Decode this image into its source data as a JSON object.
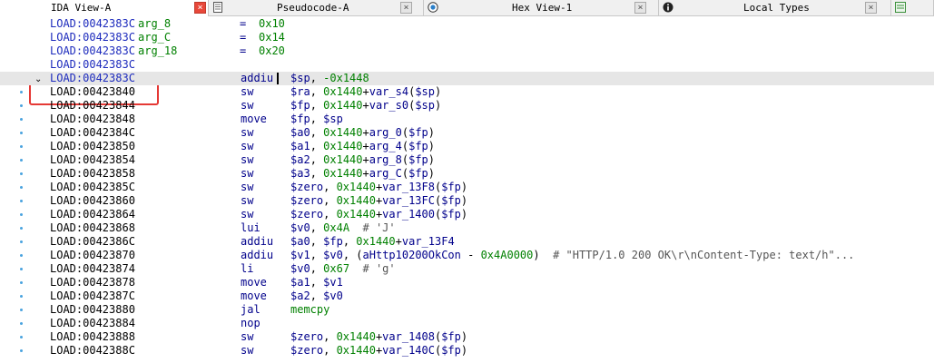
{
  "tabs": [
    {
      "label": "IDA View-A",
      "icon": "grid-icon",
      "active": true
    },
    {
      "label": "Pseudocode-A",
      "icon": "document-icon",
      "active": false
    },
    {
      "label": "Hex View-1",
      "icon": "hex-icon",
      "active": false
    },
    {
      "label": "Local Types",
      "icon": "info-icon",
      "active": false
    },
    {
      "label": "",
      "icon": "struct-icon",
      "active": false
    }
  ],
  "close_glyph": "×",
  "collapse_glyph": "⌄",
  "stack_vars": [
    {
      "addr": "LOAD:0042383C",
      "name": "arg_8",
      "eq": "=",
      "value": "0x10"
    },
    {
      "addr": "LOAD:0042383C",
      "name": "arg_C",
      "eq": "=",
      "value": "0x14"
    },
    {
      "addr": "LOAD:0042383C",
      "name": "arg_18",
      "eq": "=",
      "value": "0x20"
    },
    {
      "addr": "LOAD:0042383C",
      "name": "",
      "eq": "",
      "value": ""
    }
  ],
  "instructions": [
    {
      "addr": "LOAD:0042383C",
      "mnem": "addiu",
      "ops": [
        [
          "reg",
          "$sp"
        ],
        [
          "t",
          ", "
        ],
        [
          "num",
          "-0x1448"
        ]
      ],
      "current": true
    },
    {
      "addr": "LOAD:00423840",
      "mnem": "sw",
      "ops": [
        [
          "reg",
          "$ra"
        ],
        [
          "t",
          ", "
        ],
        [
          "num",
          "0x1440"
        ],
        [
          "t",
          "+"
        ],
        [
          "name",
          "var_s4"
        ],
        [
          "t",
          "("
        ],
        [
          "reg",
          "$sp"
        ],
        [
          "t",
          ")"
        ]
      ]
    },
    {
      "addr": "LOAD:00423844",
      "mnem": "sw",
      "ops": [
        [
          "reg",
          "$fp"
        ],
        [
          "t",
          ", "
        ],
        [
          "num",
          "0x1440"
        ],
        [
          "t",
          "+"
        ],
        [
          "name",
          "var_s0"
        ],
        [
          "t",
          "("
        ],
        [
          "reg",
          "$sp"
        ],
        [
          "t",
          ")"
        ]
      ]
    },
    {
      "addr": "LOAD:00423848",
      "mnem": "move",
      "ops": [
        [
          "reg",
          "$fp"
        ],
        [
          "t",
          ", "
        ],
        [
          "reg",
          "$sp"
        ]
      ]
    },
    {
      "addr": "LOAD:0042384C",
      "mnem": "sw",
      "ops": [
        [
          "reg",
          "$a0"
        ],
        [
          "t",
          ", "
        ],
        [
          "num",
          "0x1440"
        ],
        [
          "t",
          "+"
        ],
        [
          "name",
          "arg_0"
        ],
        [
          "t",
          "("
        ],
        [
          "reg",
          "$fp"
        ],
        [
          "t",
          ")"
        ]
      ]
    },
    {
      "addr": "LOAD:00423850",
      "mnem": "sw",
      "ops": [
        [
          "reg",
          "$a1"
        ],
        [
          "t",
          ", "
        ],
        [
          "num",
          "0x1440"
        ],
        [
          "t",
          "+"
        ],
        [
          "name",
          "arg_4"
        ],
        [
          "t",
          "("
        ],
        [
          "reg",
          "$fp"
        ],
        [
          "t",
          ")"
        ]
      ]
    },
    {
      "addr": "LOAD:00423854",
      "mnem": "sw",
      "ops": [
        [
          "reg",
          "$a2"
        ],
        [
          "t",
          ", "
        ],
        [
          "num",
          "0x1440"
        ],
        [
          "t",
          "+"
        ],
        [
          "name",
          "arg_8"
        ],
        [
          "t",
          "("
        ],
        [
          "reg",
          "$fp"
        ],
        [
          "t",
          ")"
        ]
      ]
    },
    {
      "addr": "LOAD:00423858",
      "mnem": "sw",
      "ops": [
        [
          "reg",
          "$a3"
        ],
        [
          "t",
          ", "
        ],
        [
          "num",
          "0x1440"
        ],
        [
          "t",
          "+"
        ],
        [
          "name",
          "arg_C"
        ],
        [
          "t",
          "("
        ],
        [
          "reg",
          "$fp"
        ],
        [
          "t",
          ")"
        ]
      ]
    },
    {
      "addr": "LOAD:0042385C",
      "mnem": "sw",
      "ops": [
        [
          "reg",
          "$zero"
        ],
        [
          "t",
          ", "
        ],
        [
          "num",
          "0x1440"
        ],
        [
          "t",
          "+"
        ],
        [
          "name",
          "var_13F8"
        ],
        [
          "t",
          "("
        ],
        [
          "reg",
          "$fp"
        ],
        [
          "t",
          ")"
        ]
      ]
    },
    {
      "addr": "LOAD:00423860",
      "mnem": "sw",
      "ops": [
        [
          "reg",
          "$zero"
        ],
        [
          "t",
          ", "
        ],
        [
          "num",
          "0x1440"
        ],
        [
          "t",
          "+"
        ],
        [
          "name",
          "var_13FC"
        ],
        [
          "t",
          "("
        ],
        [
          "reg",
          "$fp"
        ],
        [
          "t",
          ")"
        ]
      ]
    },
    {
      "addr": "LOAD:00423864",
      "mnem": "sw",
      "ops": [
        [
          "reg",
          "$zero"
        ],
        [
          "t",
          ", "
        ],
        [
          "num",
          "0x1440"
        ],
        [
          "t",
          "+"
        ],
        [
          "name",
          "var_1400"
        ],
        [
          "t",
          "("
        ],
        [
          "reg",
          "$fp"
        ],
        [
          "t",
          ")"
        ]
      ]
    },
    {
      "addr": "LOAD:00423868",
      "mnem": "lui",
      "ops": [
        [
          "reg",
          "$v0"
        ],
        [
          "t",
          ", "
        ],
        [
          "num",
          "0x4A"
        ],
        [
          "t",
          "  "
        ],
        [
          "cmt",
          "# 'J'"
        ]
      ]
    },
    {
      "addr": "LOAD:0042386C",
      "mnem": "addiu",
      "ops": [
        [
          "reg",
          "$a0"
        ],
        [
          "t",
          ", "
        ],
        [
          "reg",
          "$fp"
        ],
        [
          "t",
          ", "
        ],
        [
          "num",
          "0x1440"
        ],
        [
          "t",
          "+"
        ],
        [
          "name",
          "var_13F4"
        ]
      ]
    },
    {
      "addr": "LOAD:00423870",
      "mnem": "addiu",
      "ops": [
        [
          "reg",
          "$v1"
        ],
        [
          "t",
          ", "
        ],
        [
          "reg",
          "$v0"
        ],
        [
          "t",
          ", ("
        ],
        [
          "name",
          "aHttp10200OkCon"
        ],
        [
          "t",
          " - "
        ],
        [
          "num",
          "0x4A0000"
        ],
        [
          "t",
          ")  "
        ],
        [
          "cmt",
          "# \"HTTP/1.0 200 OK\\r\\nContent-Type: text/h\"..."
        ]
      ]
    },
    {
      "addr": "LOAD:00423874",
      "mnem": "li",
      "ops": [
        [
          "reg",
          "$v0"
        ],
        [
          "t",
          ", "
        ],
        [
          "num",
          "0x67"
        ],
        [
          "t",
          "  "
        ],
        [
          "cmt",
          "# 'g'"
        ]
      ]
    },
    {
      "addr": "LOAD:00423878",
      "mnem": "move",
      "ops": [
        [
          "reg",
          "$a1"
        ],
        [
          "t",
          ", "
        ],
        [
          "reg",
          "$v1"
        ]
      ]
    },
    {
      "addr": "LOAD:0042387C",
      "mnem": "move",
      "ops": [
        [
          "reg",
          "$a2"
        ],
        [
          "t",
          ", "
        ],
        [
          "reg",
          "$v0"
        ]
      ]
    },
    {
      "addr": "LOAD:00423880",
      "mnem": "jal",
      "ops": [
        [
          "sym",
          "memcpy"
        ]
      ]
    },
    {
      "addr": "LOAD:00423884",
      "mnem": "nop",
      "ops": []
    },
    {
      "addr": "LOAD:00423888",
      "mnem": "sw",
      "ops": [
        [
          "reg",
          "$zero"
        ],
        [
          "t",
          ", "
        ],
        [
          "num",
          "0x1440"
        ],
        [
          "t",
          "+"
        ],
        [
          "name",
          "var_1408"
        ],
        [
          "t",
          "("
        ],
        [
          "reg",
          "$fp"
        ],
        [
          "t",
          ")"
        ]
      ]
    },
    {
      "addr": "LOAD:0042388C",
      "mnem": "sw",
      "ops": [
        [
          "reg",
          "$zero"
        ],
        [
          "t",
          ", "
        ],
        [
          "num",
          "0x1440"
        ],
        [
          "t",
          "+"
        ],
        [
          "name",
          "var_140C"
        ],
        [
          "t",
          "("
        ],
        [
          "reg",
          "$fp"
        ],
        [
          "t",
          ")"
        ]
      ]
    }
  ],
  "colors": {
    "address_blue": "#1d2bbd",
    "address_black": "#000000",
    "mnemonic": "#00008b",
    "number": "#008000",
    "current_line_bg": "#e6e6e6",
    "annotation_box": "#e53935",
    "gutter_dot": "#4aa3df",
    "active_tab_close": "#e8483a"
  }
}
